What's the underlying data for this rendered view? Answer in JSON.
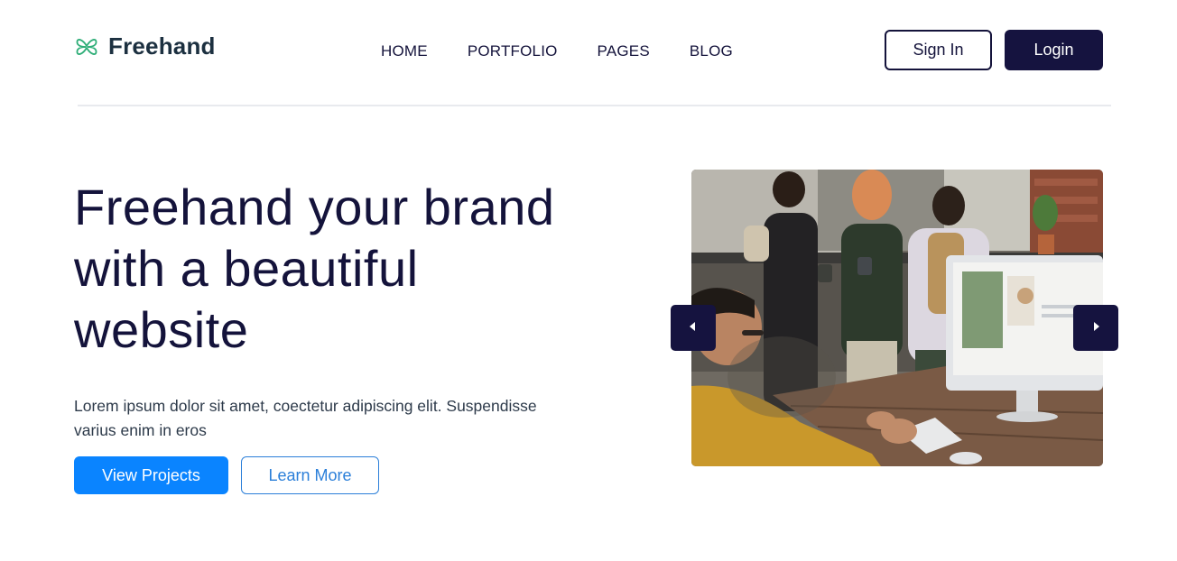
{
  "brand": {
    "name": "Freehand",
    "logo_icon": "clover-icon",
    "logo_color": "#2fae78"
  },
  "nav": {
    "items": [
      {
        "label": "HOME"
      },
      {
        "label": "PORTFOLIO"
      },
      {
        "label": "PAGES"
      },
      {
        "label": "BLOG"
      }
    ]
  },
  "header": {
    "signin_label": "Sign In",
    "login_label": "Login"
  },
  "hero": {
    "title_line1": "Freehand your brand",
    "title_line2": "with a beautiful",
    "title_line3": "website",
    "text": "Lorem ipsum dolor sit amet, coectetur adipiscing elit. Suspendisse varius enim in eros",
    "primary_label": "View Projects",
    "secondary_label": "Learn More"
  },
  "slider": {
    "image_subject": "team-meeting-photo",
    "prev_icon": "caret-left-icon",
    "next_icon": "caret-right-icon"
  },
  "colors": {
    "navy": "#15133f",
    "primary_blue": "#0a84ff",
    "outline_blue": "#2b7fd9",
    "divider": "#e8eaee"
  }
}
